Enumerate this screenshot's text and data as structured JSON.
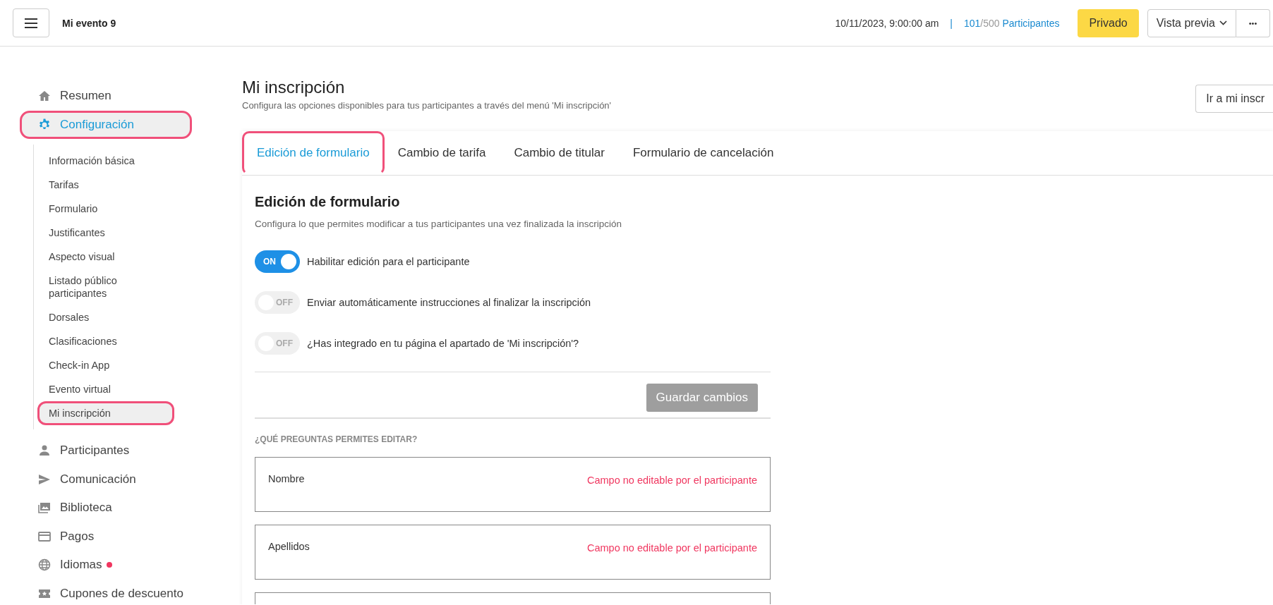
{
  "header": {
    "event_title": "Mi evento 9",
    "date": "10/11/2023, 9:00:00 am",
    "separator": "|",
    "registered": "101",
    "capacity": "/500",
    "participants_label": "Participantes",
    "privacy_button": "Privado",
    "preview_button": "Vista previa",
    "more_button": "•••"
  },
  "sidebar": {
    "items": [
      {
        "label": "Resumen",
        "selected": false,
        "highlighted": false,
        "notification": false
      },
      {
        "label": "Configuración",
        "selected": true,
        "highlighted": true,
        "notification": false,
        "children": [
          {
            "label": "Información básica",
            "selected": false,
            "highlighted": false
          },
          {
            "label": "Tarifas",
            "selected": false,
            "highlighted": false
          },
          {
            "label": "Formulario",
            "selected": false,
            "highlighted": false
          },
          {
            "label": "Justificantes",
            "selected": false,
            "highlighted": false
          },
          {
            "label": "Aspecto visual",
            "selected": false,
            "highlighted": false
          },
          {
            "label": "Listado público participantes",
            "selected": false,
            "highlighted": false
          },
          {
            "label": "Dorsales",
            "selected": false,
            "highlighted": false
          },
          {
            "label": "Clasificaciones",
            "selected": false,
            "highlighted": false
          },
          {
            "label": "Check-in App",
            "selected": false,
            "highlighted": false
          },
          {
            "label": "Evento virtual",
            "selected": false,
            "highlighted": false
          },
          {
            "label": "Mi inscripción",
            "selected": true,
            "highlighted": true
          }
        ]
      },
      {
        "label": "Participantes",
        "selected": false,
        "highlighted": false,
        "notification": false
      },
      {
        "label": "Comunicación",
        "selected": false,
        "highlighted": false,
        "notification": false
      },
      {
        "label": "Biblioteca",
        "selected": false,
        "highlighted": false,
        "notification": false
      },
      {
        "label": "Pagos",
        "selected": false,
        "highlighted": false,
        "notification": false
      },
      {
        "label": "Idiomas",
        "selected": false,
        "highlighted": false,
        "notification": true
      },
      {
        "label": "Cupones de descuento",
        "selected": false,
        "highlighted": false,
        "notification": false
      }
    ]
  },
  "page": {
    "title": "Mi inscripción",
    "subtitle": "Configura las opciones disponibles para tus participantes a través del menú 'Mi inscripción'",
    "go_button": "Ir a mi inscr"
  },
  "tabs": [
    {
      "label": "Edición de formulario",
      "selected": true,
      "highlighted": true
    },
    {
      "label": "Cambio de tarifa",
      "selected": false,
      "highlighted": false
    },
    {
      "label": "Cambio de titular",
      "selected": false,
      "highlighted": false
    },
    {
      "label": "Formulario de cancelación",
      "selected": false,
      "highlighted": false
    }
  ],
  "section": {
    "title": "Edición de formulario",
    "description": "Configura lo que permites modificar a tus participantes una vez finalizada la inscripción",
    "toggles": [
      {
        "label": "Habilitar edición para el participante",
        "on": true,
        "state_text": "ON"
      },
      {
        "label": "Enviar automáticamente instrucciones al finalizar la inscripción",
        "on": false,
        "state_text": "OFF"
      },
      {
        "label": "¿Has integrado en tu página el apartado de 'Mi inscripción'?",
        "on": false,
        "state_text": "OFF"
      }
    ],
    "save_button": {
      "label": "Guardar cambios",
      "disabled": true
    },
    "questions_heading": "¿QUÉ PREGUNTAS PERMITES EDITAR?",
    "questions": [
      {
        "name": "Nombre",
        "status": "Campo no editable por el participante"
      },
      {
        "name": "Apellidos",
        "status": "Campo no editable por el participante"
      }
    ]
  }
}
